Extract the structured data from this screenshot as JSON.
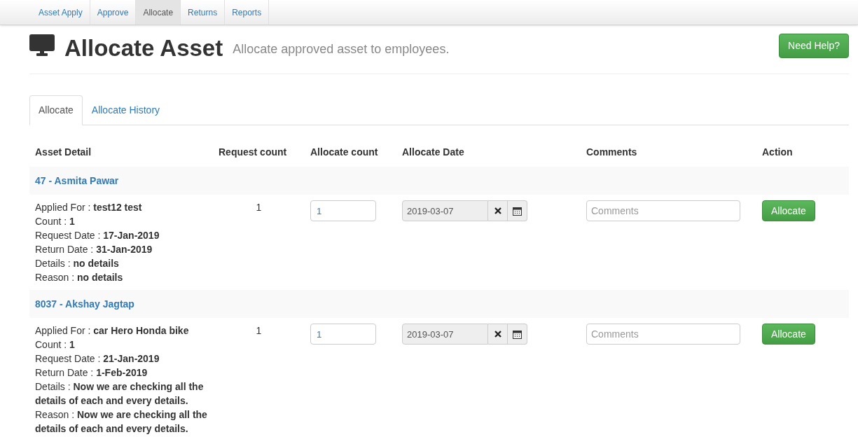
{
  "nav": [
    {
      "label": "Asset Apply",
      "selected": false
    },
    {
      "label": "Approve",
      "selected": false
    },
    {
      "label": "Allocate",
      "selected": true
    },
    {
      "label": "Returns",
      "selected": false
    },
    {
      "label": "Reports",
      "selected": false
    }
  ],
  "header": {
    "title": "Allocate Asset",
    "subtitle": "Allocate approved asset to employees.",
    "help_button": "Need Help?"
  },
  "tabs": [
    {
      "label": "Allocate",
      "selected": true
    },
    {
      "label": "Allocate History",
      "selected": false
    }
  ],
  "table": {
    "columns": [
      "Asset Detail",
      "Request count",
      "Allocate count",
      "Allocate Date",
      "Comments",
      "Action"
    ],
    "groups": [
      {
        "employee": "47 - Asmita Pawar",
        "details": [
          {
            "label": "Applied For :",
            "value": "test12 test"
          },
          {
            "label": "Count :",
            "value": "1"
          },
          {
            "label": "Request Date :",
            "value": "17-Jan-2019"
          },
          {
            "label": "Return Date :",
            "value": "31-Jan-2019"
          },
          {
            "label": "Details :",
            "value": "no details"
          },
          {
            "label": "Reason :",
            "value": "no details"
          }
        ],
        "request_count": "1",
        "allocate_count": "1",
        "allocate_date": "2019-03-07",
        "comments_placeholder": "Comments",
        "action": "Allocate"
      },
      {
        "employee": "8037 - Akshay Jagtap",
        "details": [
          {
            "label": "Applied For :",
            "value": "car Hero Honda bike"
          },
          {
            "label": "Count :",
            "value": "1"
          },
          {
            "label": "Request Date :",
            "value": "21-Jan-2019"
          },
          {
            "label": "Return Date :",
            "value": "1-Feb-2019"
          },
          {
            "label": "Details :",
            "value": "Now we are checking all the details of each and every details."
          },
          {
            "label": "Reason :",
            "value": "Now we are checking all the details of each and every details."
          }
        ],
        "request_count": "1",
        "allocate_count": "1",
        "allocate_date": "2019-03-07",
        "comments_placeholder": "Comments",
        "action": "Allocate"
      }
    ]
  }
}
